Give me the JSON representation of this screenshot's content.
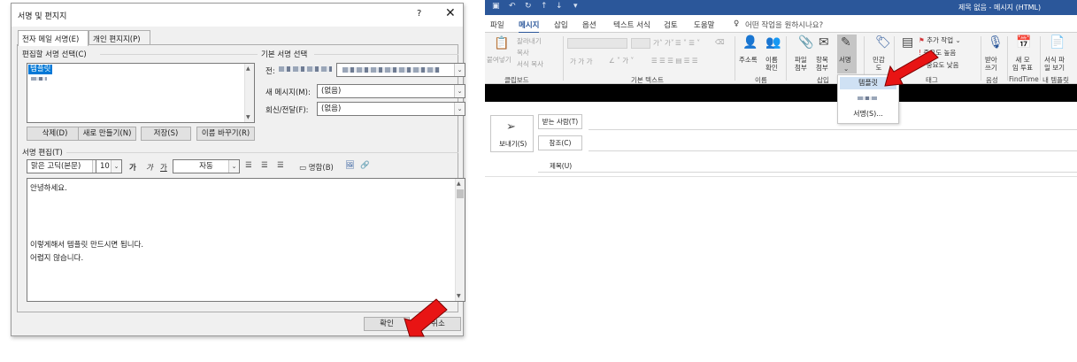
{
  "dialog": {
    "title": "서명 및 편지지",
    "help": "?",
    "close": "✕",
    "tabs": [
      "전자 메일 서명(E)",
      "개인 편지지(P)"
    ],
    "select_signature_label": "편집할 서명 선택(C)",
    "signature_list": [
      "템플릿"
    ],
    "default_signature_label": "기본 서명 선택",
    "account_label": "전:",
    "new_messages_label": "새 메시지(M):",
    "new_messages_value": "(없음)",
    "replies_label": "회신/전달(F):",
    "replies_value": "(없음)",
    "buttons": {
      "delete": "삭제(D)",
      "new": "새로 만들기(N)",
      "save": "저장(S)",
      "rename": "이름 바꾸기(R)"
    },
    "edit_label": "서명 편집(T)",
    "toolbar": {
      "font": "맑은 고딕(본문)",
      "size": "10",
      "bold": "가",
      "italic": "가",
      "underline": "가",
      "color": "자동",
      "business_card": "명함(B)"
    },
    "signature_text": [
      "안녕하세요.",
      "",
      "",
      "",
      "이렇게해서 템플릿 만드시면 됩니다.",
      "어렵지 않습니다."
    ],
    "ok": "확인",
    "cancel": "취소"
  },
  "outlook": {
    "window_title": "제목 없음 - 메시지 (HTML)",
    "tabs": [
      "파일",
      "메시지",
      "삽입",
      "옵션",
      "텍스트 서식",
      "검토",
      "도움말"
    ],
    "tell_me": "어떤 작업을 원하시나요?",
    "ribbon": {
      "paste": "붙여넣기",
      "cut": "잘라내기",
      "copy": "복사",
      "format_painter": "서식 복사",
      "clipboard_group": "클립보드",
      "basic_text_group": "기본 텍스트",
      "address_book": "주소록",
      "check_names": "이름\n확인",
      "names_group": "이름",
      "attach_file": "파일\n첨부",
      "attach_item": "항목\n첨부",
      "signature": "서명",
      "insert_group": "삽입",
      "voting": "민감\n도",
      "follow_up": "추가 작업",
      "high_importance": "중요도 높음",
      "low_importance": "중요도 낮음",
      "tags_group": "태그",
      "dictate": "받아\n쓰기",
      "voice_group": "음성",
      "new_poll": "새 모\n임 투표",
      "findtime_group": "FindTime",
      "view_templates": "서식 파\n일 보기",
      "templates_group": "내 템플릿"
    },
    "signature_menu": [
      "템플릿",
      "서명(S)..."
    ],
    "send": "보내기(S)",
    "to": "받는 사람(T)",
    "cc": "참조(C)",
    "subject": "제목(U)"
  }
}
